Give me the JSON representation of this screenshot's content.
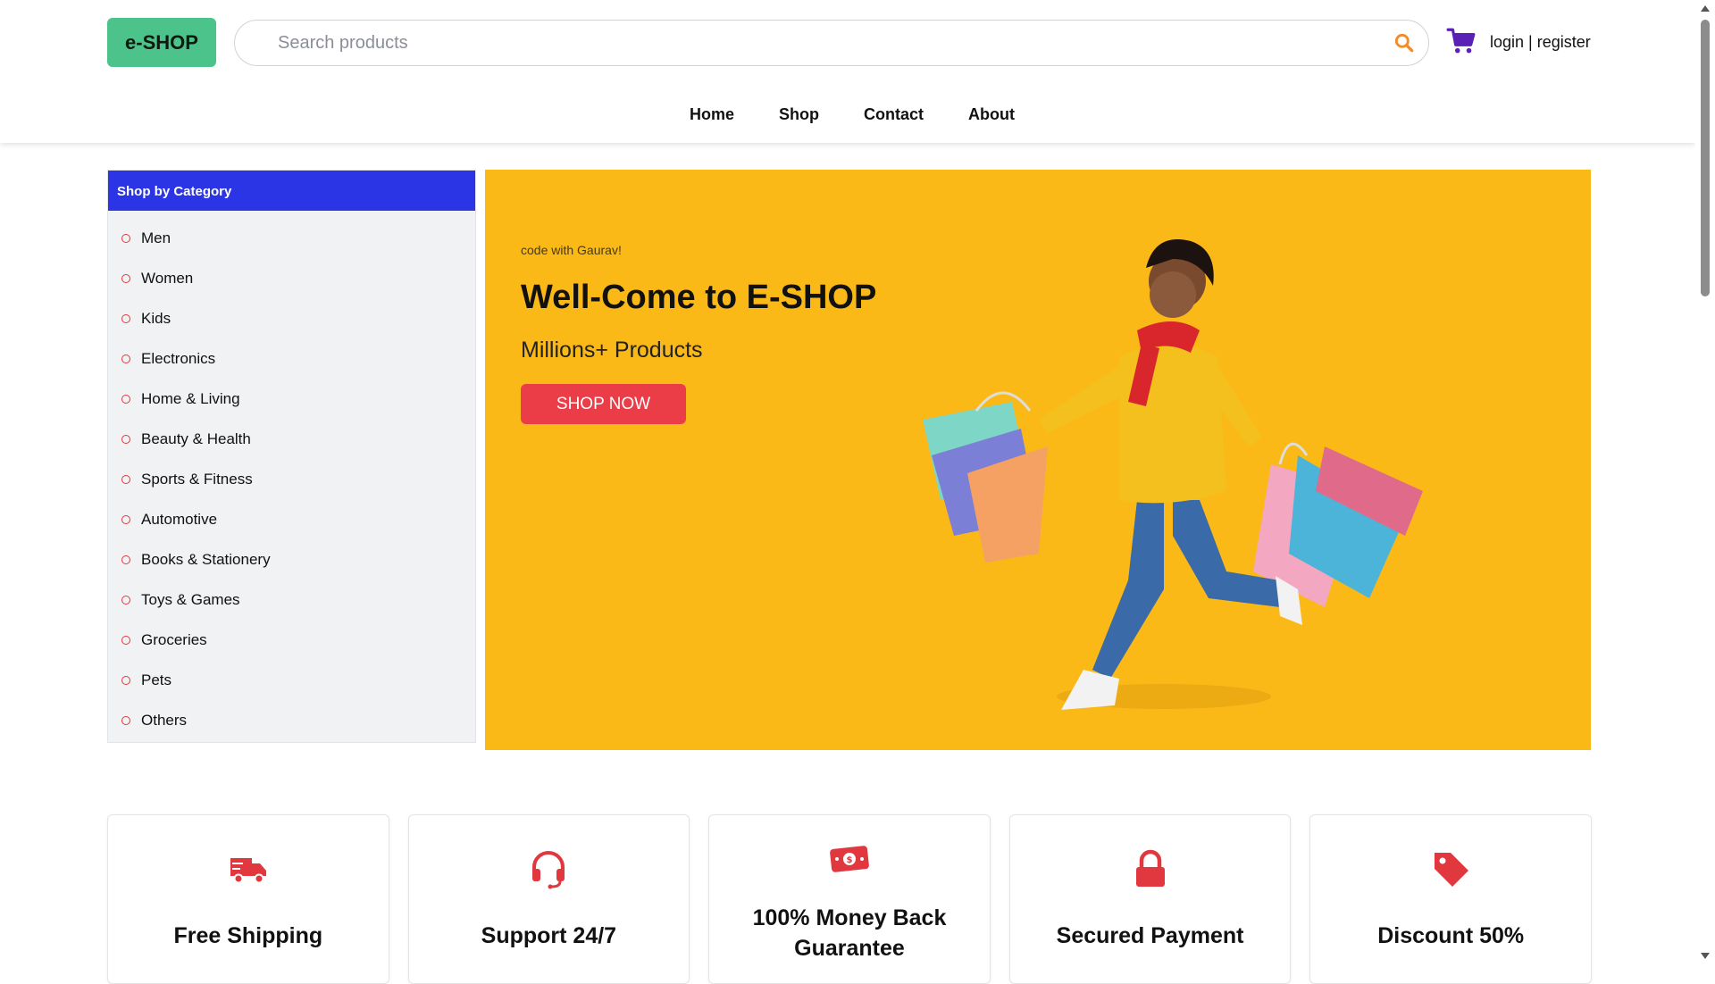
{
  "header": {
    "logo": "e-SHOP",
    "search_placeholder": "Search products",
    "login_label": "login",
    "separator": "|",
    "register_label": "register",
    "nav": [
      "Home",
      "Shop",
      "Contact",
      "About"
    ]
  },
  "sidebar": {
    "title": "Shop by Category",
    "items": [
      "Men",
      "Women",
      "Kids",
      "Electronics",
      "Home & Living",
      "Beauty & Health",
      "Sports & Fitness",
      "Automotive",
      "Books & Stationery",
      "Toys & Games",
      "Groceries",
      "Pets",
      "Others"
    ]
  },
  "hero": {
    "tag": "code with Gaurav!",
    "title": "Well-Come to E-SHOP",
    "subtitle": "Millions+ Products",
    "button": "SHOP NOW"
  },
  "features": [
    {
      "title": "Free Shipping",
      "icon": "truck-icon"
    },
    {
      "title": "Support 24/7",
      "icon": "headset-icon"
    },
    {
      "title": "100% Money Back Guarantee",
      "icon": "money-icon"
    },
    {
      "title": "Secured Payment",
      "icon": "lock-icon"
    },
    {
      "title": "Discount 50%",
      "icon": "tag-icon"
    }
  ],
  "colors": {
    "logo_bg": "#4cc38a",
    "sidebar_header": "#2b35e6",
    "hero_bg": "#fbb917",
    "accent_red": "#eb3d48",
    "cart": "#5b21b6",
    "search_icon": "#f28c28"
  }
}
